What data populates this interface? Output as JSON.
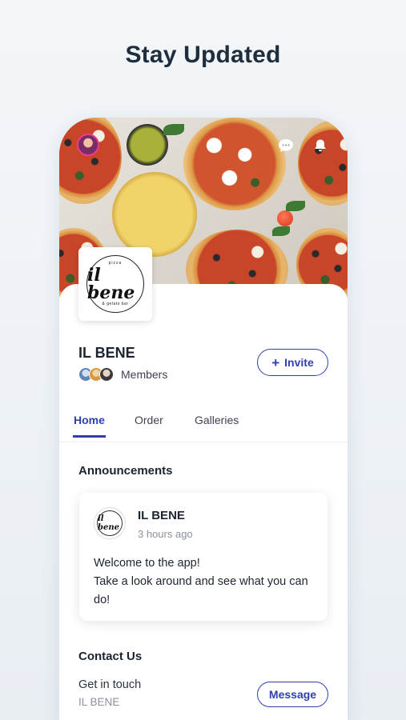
{
  "headline": "Stay Updated",
  "hero": {
    "chat_icon": "chat-bubble-icon",
    "bell_icon": "bell-icon"
  },
  "business": {
    "logo_text": "il bene",
    "logo_top_text": "pizza",
    "logo_bottom_text": "& gelato bar",
    "name": "IL BENE",
    "members_label": "Members"
  },
  "actions": {
    "invite_label": "Invite",
    "invite_icon": "plus-icon"
  },
  "tabs": [
    {
      "label": "Home",
      "active": true
    },
    {
      "label": "Order",
      "active": false
    },
    {
      "label": "Galleries",
      "active": false
    }
  ],
  "announcements": {
    "title": "Announcements",
    "post": {
      "author": "IL BENE",
      "logo_text": "il bene",
      "time": "3 hours ago",
      "body_line1": "Welcome to the app!",
      "body_line2": "Take a look around and see what you can do!"
    }
  },
  "contact": {
    "title": "Contact Us",
    "subtitle": "Get in touch",
    "name": "IL BENE",
    "message_label": "Message"
  },
  "colors": {
    "accent": "#2f3fb0",
    "headline": "#1f2e3d",
    "muted": "#8a929c"
  }
}
